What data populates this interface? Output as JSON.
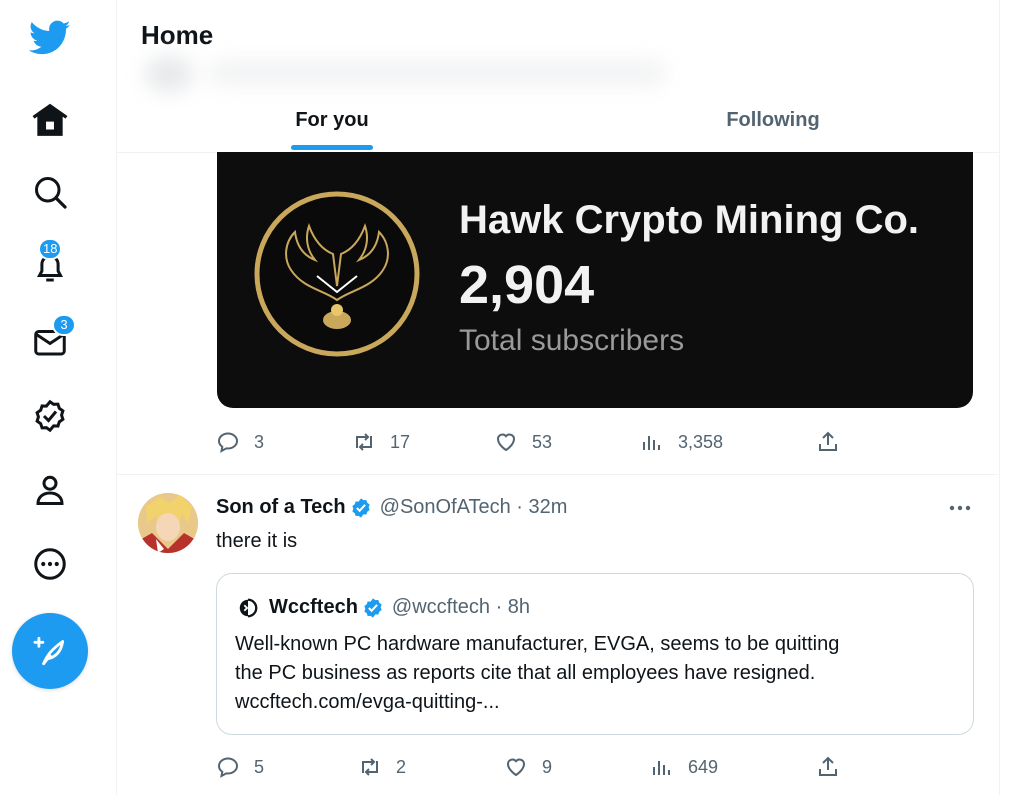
{
  "nav": {
    "notifications_badge": "18",
    "messages_badge": "3"
  },
  "header": {
    "title": "Home",
    "tabs": [
      {
        "label": "For you"
      },
      {
        "label": "Following"
      }
    ]
  },
  "card": {
    "name": "Hawk Crypto Mining Co.",
    "number": "2,904",
    "caption": "Total subscribers"
  },
  "tweet1_actions": {
    "replies": "3",
    "retweets": "17",
    "likes": "53",
    "views": "3,358"
  },
  "tweet2": {
    "name": "Son of a Tech",
    "handle": "@SonOfATech · 32m",
    "text": "there it is",
    "quote": {
      "name": "Wccftech",
      "handle": "@wccftech · 8h",
      "lines": [
        "Well-known PC hardware manufacturer, EVGA, seems to be quitting",
        "the PC business as reports cite that all employees have resigned.",
        "wccftech.com/evga-quitting-..."
      ]
    },
    "actions": {
      "replies": "5",
      "retweets": "2",
      "likes": "9",
      "views": "649"
    }
  },
  "colors": {
    "accent": "#1d9bf0",
    "text_secondary": "#536471",
    "card_bg": "#0d0d0d",
    "gold": "#c9a85c"
  }
}
